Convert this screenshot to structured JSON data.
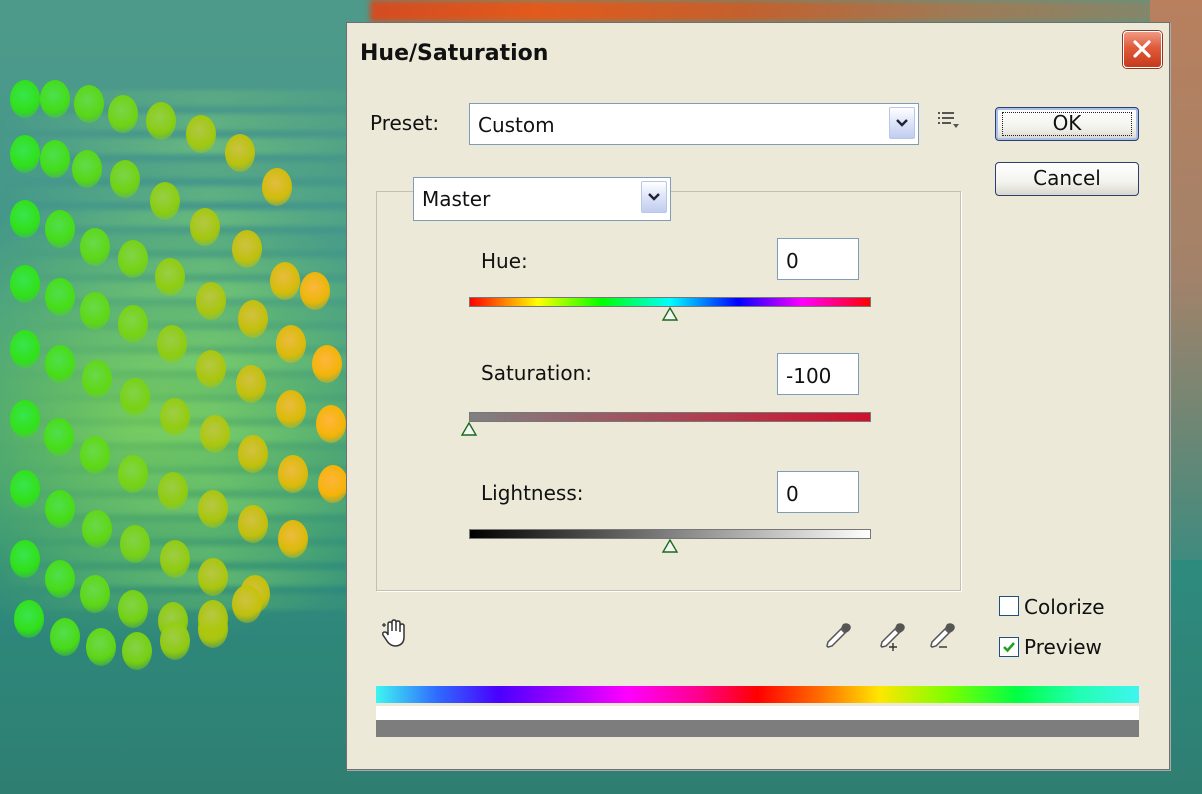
{
  "dialog": {
    "title": "Hue/Saturation",
    "preset_label": "Preset:",
    "preset_value": "Custom",
    "channel_value": "Master",
    "ok_label": "OK",
    "cancel_label": "Cancel",
    "colorize_label": "Colorize",
    "preview_label": "Preview",
    "colorize_checked": false,
    "preview_checked": true
  },
  "sliders": [
    {
      "label": "Hue:",
      "value": "0",
      "min": -180,
      "max": 180,
      "position": 0
    },
    {
      "label": "Saturation:",
      "value": "-100",
      "min": -100,
      "max": 100,
      "position": -100
    },
    {
      "label": "Lightness:",
      "value": "0",
      "min": -100,
      "max": 100,
      "position": 0
    }
  ],
  "icons": [
    "close-icon",
    "preset-options-icon",
    "dropdown-arrow-icon",
    "hand-adjust-icon",
    "eyedropper-icon",
    "eyedropper-plus-icon",
    "eyedropper-minus-icon"
  ],
  "colors": {
    "dialog_bg": "#ece9d8",
    "close_button": "#e05a3a",
    "focus_blue": "#7f9db9"
  }
}
